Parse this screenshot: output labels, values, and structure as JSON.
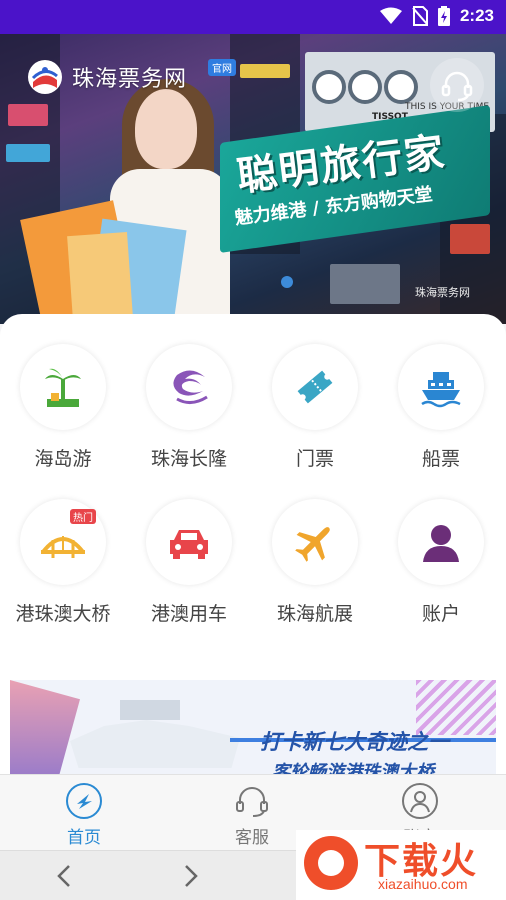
{
  "status_bar": {
    "time": "2:23"
  },
  "brand": {
    "name": "珠海票务网",
    "badge": "官网"
  },
  "banner": {
    "slogan_main": "聪明旅行家",
    "slogan_sub": "魅力维港 / 东方购物天堂",
    "billboard_text": "THIS IS YOUR TIME",
    "billboard_brand": "TISSOT",
    "brand_stamp": "珠海票务网"
  },
  "grid": {
    "items": [
      {
        "label": "海岛游",
        "icon": "palm-tree-icon"
      },
      {
        "label": "珠海长隆",
        "icon": "chimelong-logo-icon"
      },
      {
        "label": "门票",
        "icon": "ticket-icon"
      },
      {
        "label": "船票",
        "icon": "ship-icon"
      },
      {
        "label": "港珠澳大桥",
        "icon": "bridge-icon",
        "badge": "热门"
      },
      {
        "label": "港澳用车",
        "icon": "car-icon"
      },
      {
        "label": "珠海航展",
        "icon": "airplane-icon"
      },
      {
        "label": "账户",
        "icon": "user-icon"
      }
    ]
  },
  "promo": {
    "title": "打卡新七大奇迹之一",
    "subtitle": "客轮畅游港珠澳大桥"
  },
  "tabbar": {
    "tabs": [
      {
        "label": "首页",
        "icon": "home-icon",
        "active": true
      },
      {
        "label": "客服",
        "icon": "headset-icon"
      },
      {
        "label": "账户",
        "icon": "account-icon"
      }
    ]
  },
  "watermark": {
    "title": "下载火",
    "url": "xiazaihuo.com"
  },
  "colors": {
    "status_bar": "#4b13c9",
    "accent": "#2a8ad3",
    "hot": "#e8454a"
  }
}
